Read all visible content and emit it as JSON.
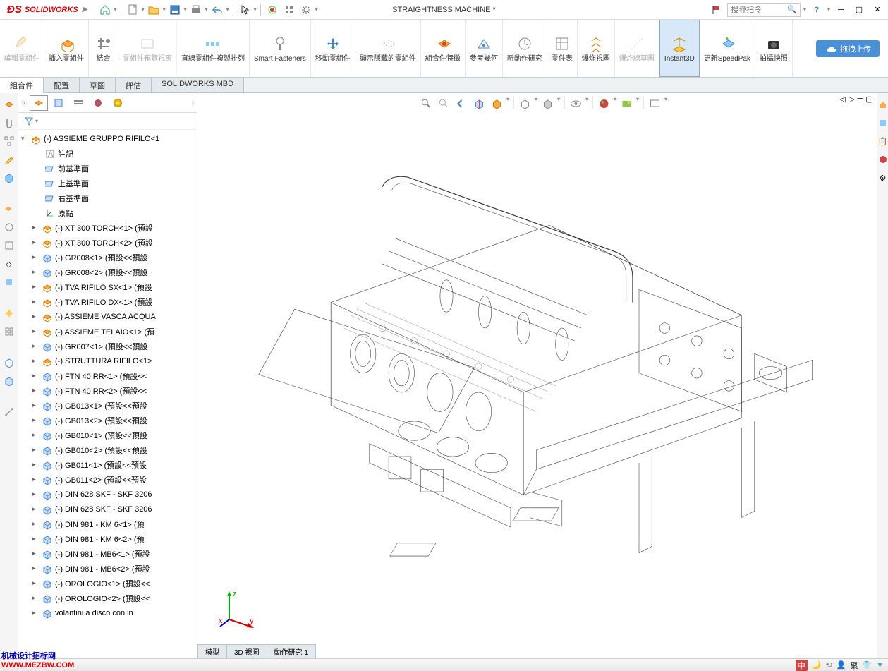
{
  "app": {
    "name": "SOLIDWORKS",
    "doc_title": "STRAIGHTNESS MACHINE *"
  },
  "search": {
    "placeholder": "搜尋指令"
  },
  "titlebar_icons": [
    "home-icon",
    "new-doc-icon",
    "open-doc-icon",
    "save-icon",
    "print-icon",
    "undo-icon",
    "select-icon",
    "rebuild-icon",
    "options-icon",
    "settings-icon"
  ],
  "ribbon": [
    {
      "id": "edit-component",
      "label": "編輯零組件",
      "disabled": true
    },
    {
      "id": "insert-component",
      "label": "插入零組件"
    },
    {
      "id": "mate",
      "label": "結合"
    },
    {
      "id": "component-preview",
      "label": "零組件預覽視窗",
      "disabled": true
    },
    {
      "id": "linear-pattern",
      "label": "直線零組件複製排列"
    },
    {
      "id": "smart-fasteners",
      "label": "Smart Fasteners"
    },
    {
      "id": "move-component",
      "label": "移動零組件"
    },
    {
      "id": "show-hidden",
      "label": "顯示隱藏的零組件"
    },
    {
      "id": "assembly-features",
      "label": "組合件特徵"
    },
    {
      "id": "reference-geometry",
      "label": "參考幾何"
    },
    {
      "id": "new-motion-study",
      "label": "新動作研究"
    },
    {
      "id": "bom",
      "label": "零件表"
    },
    {
      "id": "exploded-view",
      "label": "爆炸視圖"
    },
    {
      "id": "explode-line-sketch",
      "label": "爆炸線草圖",
      "disabled": true
    },
    {
      "id": "instant3d",
      "label": "Instant3D",
      "active": true
    },
    {
      "id": "update-speedpak",
      "label": "更新SpeedPak"
    },
    {
      "id": "snapshot",
      "label": "拍攝快照"
    }
  ],
  "upload_button": "拖拽上传",
  "tabs": [
    {
      "id": "assembly",
      "label": "組合件",
      "active": true
    },
    {
      "id": "layout",
      "label": "配置"
    },
    {
      "id": "sketch",
      "label": "草圖"
    },
    {
      "id": "evaluate",
      "label": "評估"
    },
    {
      "id": "mbd",
      "label": "SOLIDWORKS MBD"
    }
  ],
  "tree_root": "(-) ASSIEME GRUPPO RIFILO<1",
  "tree_fixed": [
    {
      "icon": "annotation",
      "label": "註記"
    },
    {
      "icon": "plane",
      "label": "前基準面"
    },
    {
      "icon": "plane",
      "label": "上基準面"
    },
    {
      "icon": "plane",
      "label": "右基準面"
    },
    {
      "icon": "origin",
      "label": "原點"
    }
  ],
  "tree_parts": [
    {
      "type": "asm",
      "label": "(-) XT 300 TORCH<1> (預設"
    },
    {
      "type": "asm",
      "label": "(-) XT 300 TORCH<2> (預設"
    },
    {
      "type": "part",
      "label": "(-) GR008<1> (預設<<預設"
    },
    {
      "type": "part",
      "label": "(-) GR008<2> (預設<<預設"
    },
    {
      "type": "asm",
      "label": "(-) TVA RIFILO SX<1> (預設"
    },
    {
      "type": "asm",
      "label": "(-) TVA RIFILO DX<1> (預設"
    },
    {
      "type": "asm",
      "label": "(-) ASSIEME VASCA ACQUA"
    },
    {
      "type": "asm",
      "label": "(-) ASSIEME TELAIO<1> (預"
    },
    {
      "type": "part",
      "label": "(-) GR007<1> (預設<<預設"
    },
    {
      "type": "asm",
      "label": "(-) STRUTTURA RIFILO<1>"
    },
    {
      "type": "part",
      "label": "(-) FTN 40 RR<1> (預設<<"
    },
    {
      "type": "part",
      "label": "(-) FTN 40 RR<2> (預設<<"
    },
    {
      "type": "part",
      "label": "(-) GB013<1> (預設<<預設"
    },
    {
      "type": "part",
      "label": "(-) GB013<2> (預設<<預設"
    },
    {
      "type": "part",
      "label": "(-) GB010<1> (預設<<預設"
    },
    {
      "type": "part",
      "label": "(-) GB010<2> (預設<<預設"
    },
    {
      "type": "part",
      "label": "(-) GB011<1> (預設<<預設"
    },
    {
      "type": "part",
      "label": "(-) GB011<2> (預設<<預設"
    },
    {
      "type": "part",
      "label": "(-) DIN 628 SKF - SKF 3206"
    },
    {
      "type": "part",
      "label": "(-) DIN 628 SKF - SKF 3206"
    },
    {
      "type": "part",
      "label": "(-) DIN 981 - KM 6<1> (預"
    },
    {
      "type": "part",
      "label": "(-) DIN 981 - KM 6<2> (預"
    },
    {
      "type": "part",
      "label": "(-) DIN 981 - MB6<1> (預設"
    },
    {
      "type": "part",
      "label": "(-) DIN 981 - MB6<2> (預設"
    },
    {
      "type": "part",
      "label": "(-) OROLOGIO<1> (預設<<"
    },
    {
      "type": "part",
      "label": "(-) OROLOGIO<2> (預設<<"
    },
    {
      "type": "part",
      "label": "volantini a disco con in"
    }
  ],
  "bottom_tabs": [
    "模型",
    "3D 視圖",
    "動作研究 1"
  ],
  "status": {
    "ime": "中",
    "items": [
      "聚"
    ]
  },
  "triad": {
    "x": "x",
    "y": "y",
    "z": "z"
  },
  "watermark": {
    "l1": "机械设计招标网",
    "l2": "WWW.MEZBW.COM"
  }
}
